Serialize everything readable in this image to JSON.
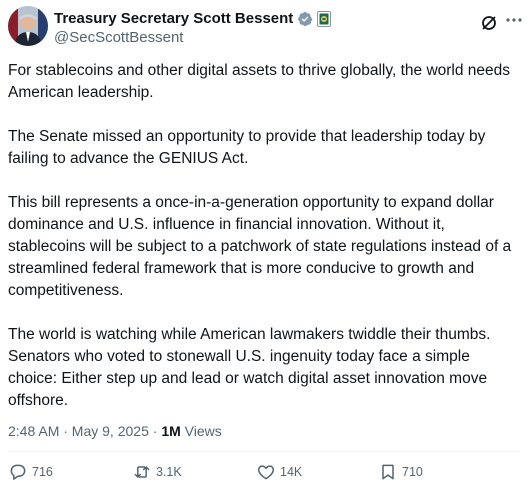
{
  "author": {
    "display_name": "Treasury Secretary Scott Bessent",
    "handle": "@SecScottBessent",
    "verified_icon": "verified-badge-icon",
    "affiliation_icon": "treasury-seal-icon",
    "avatar": "avatar-photo"
  },
  "header_actions": {
    "grok_icon": "grok-icon",
    "more_icon": "more-options-icon"
  },
  "tweet": {
    "paragraphs": [
      "For stablecoins and other digital assets to thrive globally, the world needs American leadership.",
      "The Senate missed an opportunity to provide that leadership today by failing to advance the GENIUS Act.",
      "This bill represents a once-in-a-generation opportunity to expand dollar dominance and U.S. influence in financial innovation. Without it, stablecoins will be subject to a patchwork of state regulations instead of a streamlined federal framework that is more conducive to growth and competitiveness.",
      "The world is watching while American lawmakers twiddle their thumbs. Senators who voted to stonewall U.S. ingenuity today face a simple choice: Either step up and lead or watch digital asset innovation move offshore."
    ],
    "timestamp": "2:48 AM · May 9, 2025",
    "separator": "·",
    "views_count": "1M",
    "views_label": "Views"
  },
  "actions": {
    "reply": {
      "count": "716",
      "icon": "reply-icon"
    },
    "repost": {
      "count": "3.1K",
      "icon": "repost-icon"
    },
    "like": {
      "count": "14K",
      "icon": "like-icon"
    },
    "bookmark": {
      "count": "710",
      "icon": "bookmark-icon"
    }
  },
  "colors": {
    "text_primary": "#0f1419",
    "text_secondary": "#536471",
    "verified_gray": "#829aab",
    "divider": "#eff3f4"
  }
}
